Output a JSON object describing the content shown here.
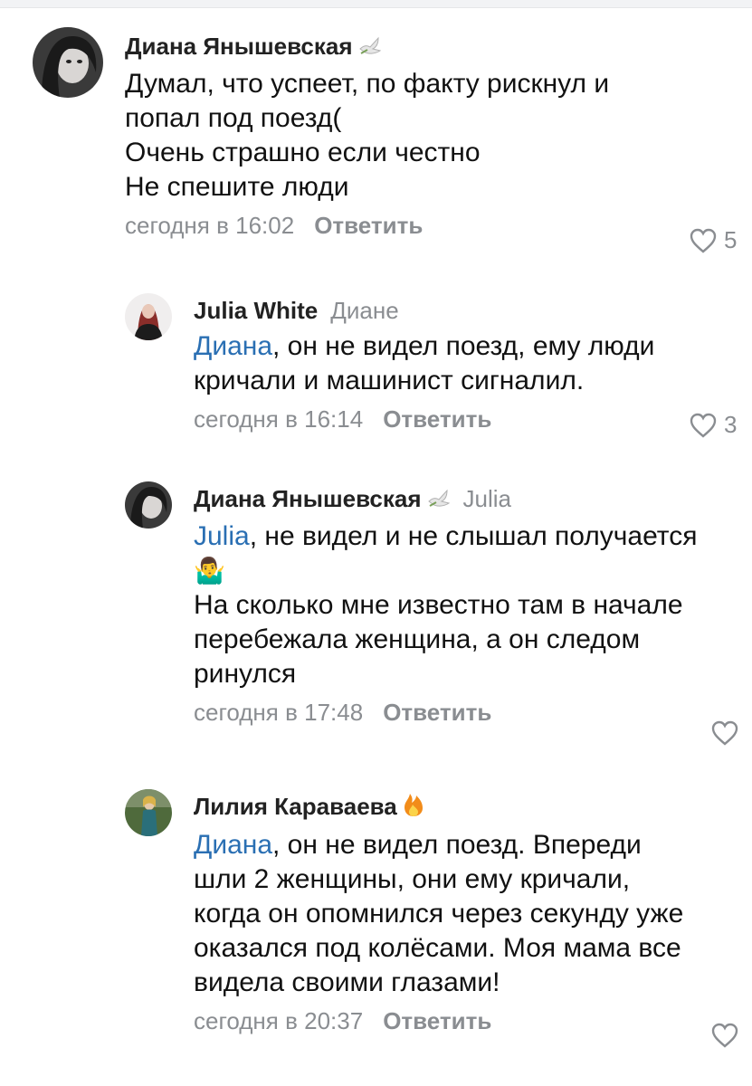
{
  "comments": [
    {
      "author": "Диана Янышевская",
      "badge_icon": "dove-icon",
      "reply_to": "",
      "mention": "",
      "text": "Думал, что успеет, по факту рискнул и\nпопал под поезд(\nОчень страшно если честно\nНе спешите люди",
      "time": "сегодня в 16:02",
      "reply_label": "Ответить",
      "likes": "5"
    },
    {
      "author": "Julia White",
      "badge_icon": "",
      "reply_to": "Диане",
      "mention": "Диана",
      "text": ", он не видел поезд, ему люди\nкричали и машинист сигналил.",
      "time": "сегодня в 16:14",
      "reply_label": "Ответить",
      "likes": "3"
    },
    {
      "author": "Диана Янышевская",
      "badge_icon": "dove-icon",
      "reply_to": "Julia",
      "mention": "Julia",
      "text": ", не видел и не слышал получается",
      "emoji": "🤷‍♂️",
      "text2": "На сколько мне известно  там в начале\nперебежала женщина, а он следом\nринулся",
      "time": "сегодня в 17:48",
      "reply_label": "Ответить",
      "likes": ""
    },
    {
      "author": "Лилия Караваева",
      "badge_icon": "fire-icon",
      "reply_to": "",
      "mention": "Диана",
      "text": ", он не видел поезд. Впереди\nшли 2 женщины, они ему кричали,\nкогда он опомнился через секунду уже\nоказался под колёсами. Моя мама все\nвидела своими глазами!",
      "time": "сегодня в 20:37",
      "reply_label": "Ответить",
      "likes": ""
    }
  ]
}
